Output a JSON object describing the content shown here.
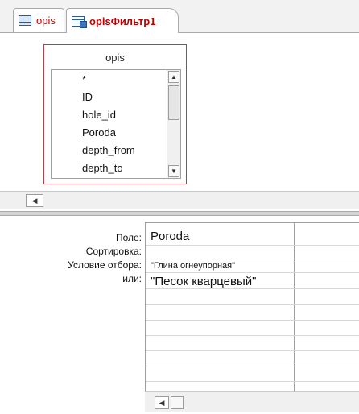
{
  "tabs": [
    {
      "label": "opis",
      "icon": "table-icon"
    },
    {
      "label": "opisФильтр1",
      "icon": "query-icon"
    }
  ],
  "table": {
    "name": "opis",
    "fields": [
      "*",
      "ID",
      "hole_id",
      "Poroda",
      "depth_from",
      "depth_to"
    ]
  },
  "grid": {
    "row_labels": [
      "Поле:",
      "Сортировка:",
      "Условие отбора:",
      "или:"
    ],
    "column1": {
      "field": "Poroda",
      "sort": "",
      "criteria": "\"Глина огнеупорная\"",
      "or": "\"Песок кварцевый\""
    }
  }
}
